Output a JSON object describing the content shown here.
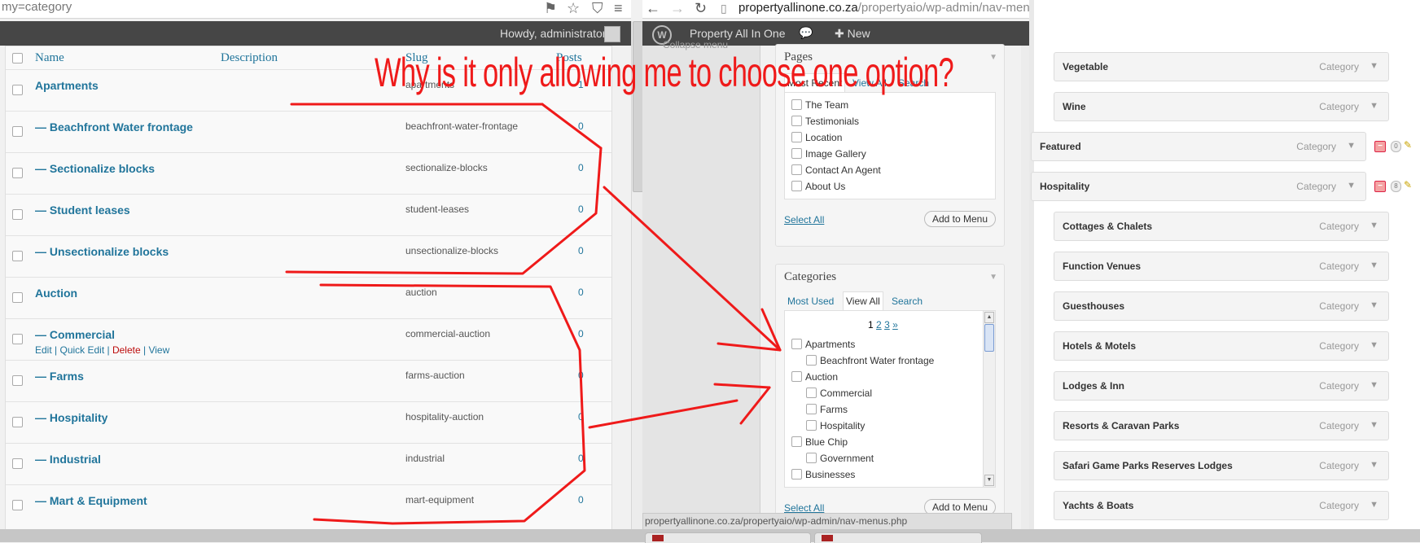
{
  "left": {
    "url_fragment": "my=category",
    "howdy": "Howdy, administrator",
    "columns": {
      "name": "Name",
      "description": "Description",
      "slug": "Slug",
      "posts": "Posts"
    },
    "rows": [
      {
        "name": "Apartments",
        "slug": "apartments",
        "posts": "1"
      },
      {
        "name": "— Beachfront Water frontage",
        "slug": "beachfront-water-frontage",
        "posts": "0"
      },
      {
        "name": "— Sectionalize blocks",
        "slug": "sectionalize-blocks",
        "posts": "0"
      },
      {
        "name": "— Student leases",
        "slug": "student-leases",
        "posts": "0"
      },
      {
        "name": "— Unsectionalize blocks",
        "slug": "unsectionalize-blocks",
        "posts": "0"
      },
      {
        "name": "Auction",
        "slug": "auction",
        "posts": "0"
      },
      {
        "name": "— Commercial",
        "slug": "commercial-auction",
        "posts": "0",
        "actions": {
          "edit": "Edit",
          "quick_edit": "Quick Edit",
          "delete": "Delete",
          "view": "View"
        }
      },
      {
        "name": "— Farms",
        "slug": "farms-auction",
        "posts": "0"
      },
      {
        "name": "— Hospitality",
        "slug": "hospitality-auction",
        "posts": "0"
      },
      {
        "name": "— Industrial",
        "slug": "industrial",
        "posts": "0"
      },
      {
        "name": "— Mart & Equipment",
        "slug": "mart-equipment",
        "posts": "0"
      }
    ]
  },
  "middle": {
    "url_host": "propertyallinone.co.za",
    "url_path": "/propertyaio/wp-admin/nav-menus.php",
    "site_name": "Property All In One",
    "new_label": "New",
    "collapse_menu": "Collapse menu",
    "pages_box": {
      "title": "Pages",
      "tabs": [
        "Most Recent",
        "View All",
        "Search"
      ],
      "items": [
        "The Team",
        "Testimonials",
        "Location",
        "Image Gallery",
        "Contact An Agent",
        "About Us"
      ],
      "select_all": "Select All",
      "add_to_menu": "Add to Menu"
    },
    "categories_box": {
      "title": "Categories",
      "tabs": [
        "Most Used",
        "View All",
        "Search"
      ],
      "pagination": {
        "current": "1",
        "p2": "2",
        "p3": "3",
        "next": "»"
      },
      "items": [
        {
          "label": "Apartments",
          "child": false
        },
        {
          "label": "Beachfront Water frontage",
          "child": true
        },
        {
          "label": "Auction",
          "child": false
        },
        {
          "label": "Commercial",
          "child": true
        },
        {
          "label": "Farms",
          "child": true
        },
        {
          "label": "Hospitality",
          "child": true
        },
        {
          "label": "Blue Chip",
          "child": false
        },
        {
          "label": "Government",
          "child": true
        },
        {
          "label": "Businesses",
          "child": false
        }
      ],
      "select_all": "Select All",
      "add_to_menu": "Add to Menu"
    },
    "status_url": "propertyallinone.co.za/propertyaio/wp-admin/nav-menus.php"
  },
  "right": {
    "items": [
      {
        "title": "Vegetable",
        "type": "Category",
        "indent": true
      },
      {
        "title": "Wine",
        "type": "Category",
        "indent": true
      },
      {
        "title": "Featured",
        "type": "Category",
        "indent": false,
        "count": "0"
      },
      {
        "title": "Hospitality",
        "type": "Category",
        "indent": false,
        "count": "8"
      },
      {
        "title": "Cottages & Chalets",
        "type": "Category",
        "indent": true
      },
      {
        "title": "Function Venues",
        "type": "Category",
        "indent": true
      },
      {
        "title": "Guesthouses",
        "type": "Category",
        "indent": true
      },
      {
        "title": "Hotels & Motels",
        "type": "Category",
        "indent": true
      },
      {
        "title": "Lodges & Inn",
        "type": "Category",
        "indent": true
      },
      {
        "title": "Resorts & Caravan Parks",
        "type": "Category",
        "indent": true
      },
      {
        "title": "Safari Game Parks Reserves Lodges",
        "type": "Category",
        "indent": true
      },
      {
        "title": "Yachts & Boats",
        "type": "Category",
        "indent": true
      }
    ]
  },
  "annotation": {
    "text": "Why is it only allowing me to choose one option?",
    "color": "#ef1a1a"
  },
  "colors": {
    "link": "#21759b",
    "admin_bar": "#464646",
    "delete": "#bc0b0b"
  }
}
